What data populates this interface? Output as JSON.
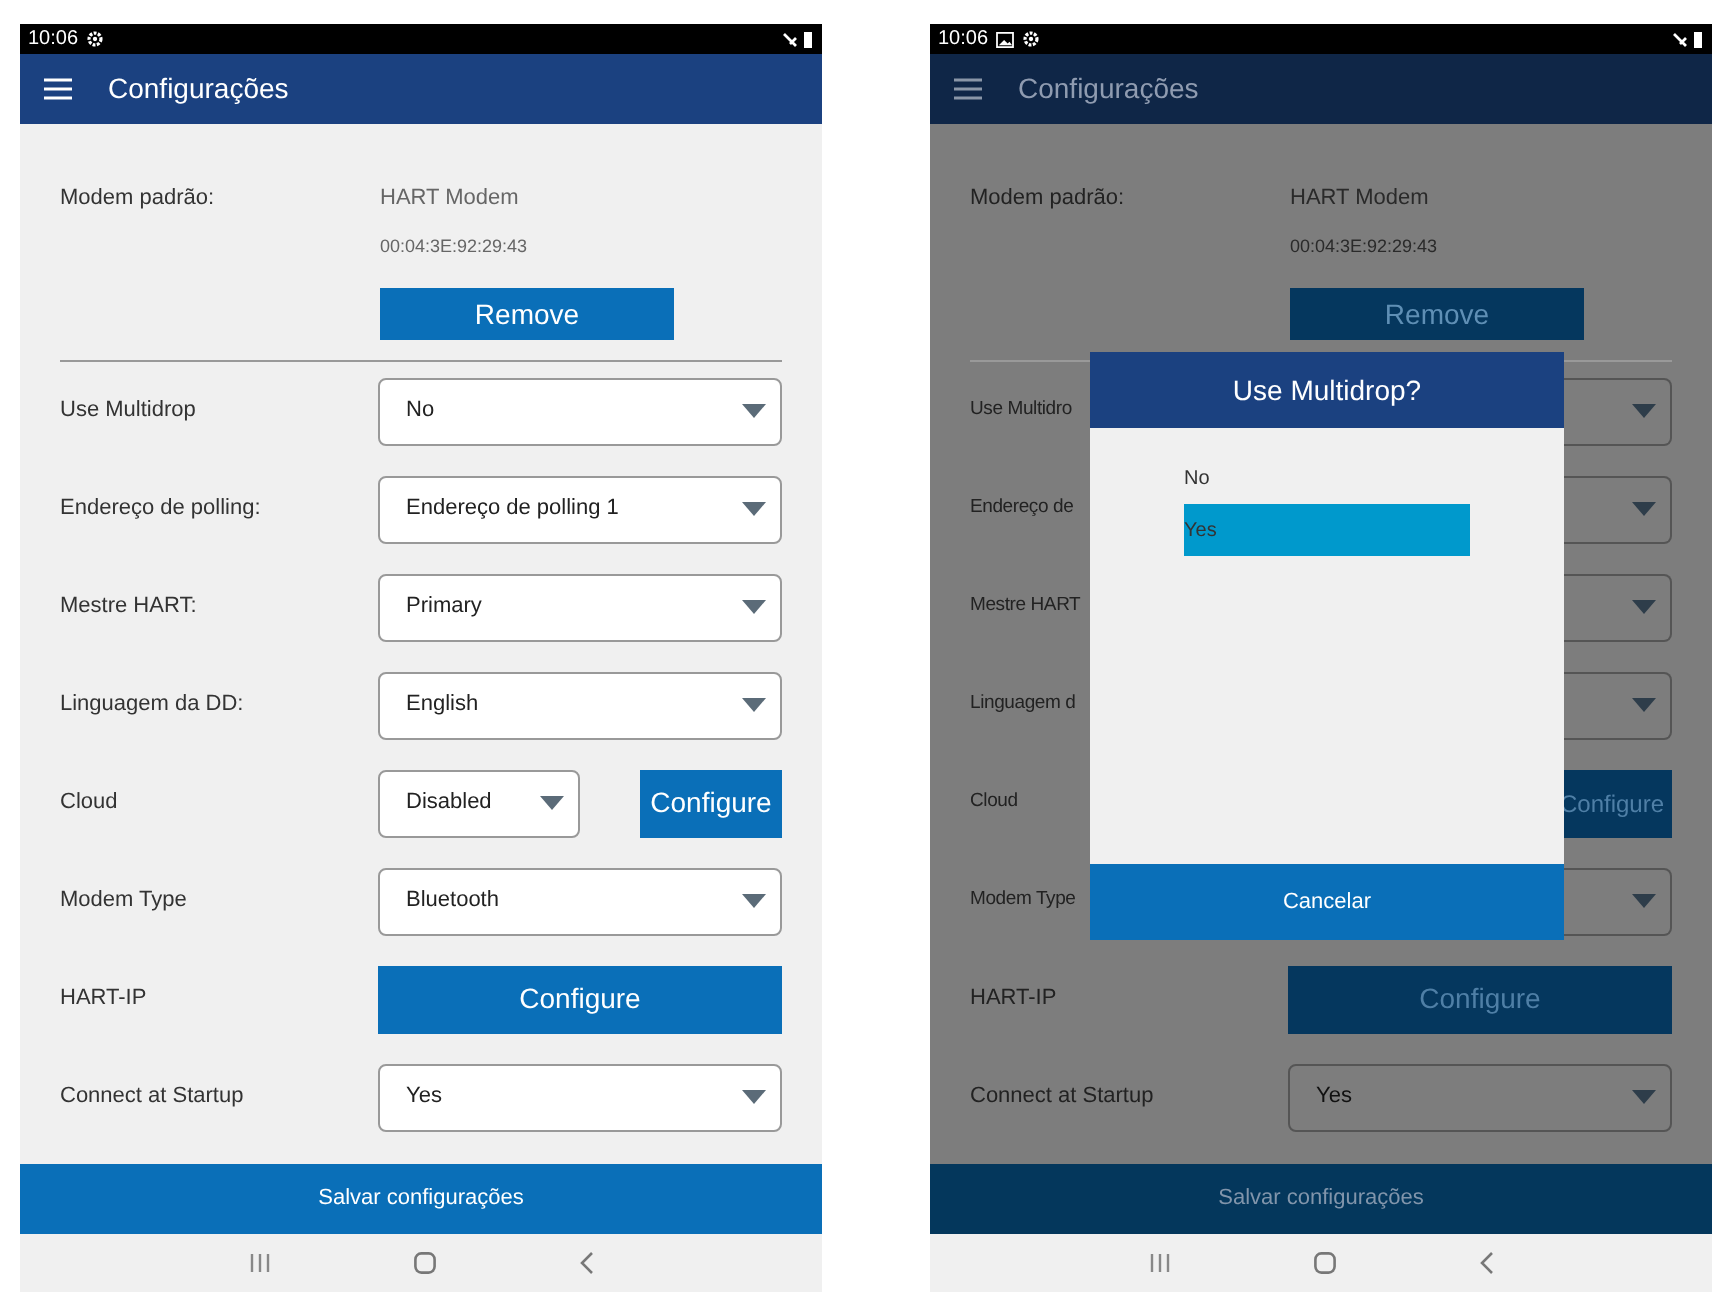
{
  "screens": [
    {
      "dimmed": false,
      "status_bar": {
        "time": "10:06",
        "picture_notification": false
      },
      "title": "Configurações",
      "modem": {
        "label": "Modem padrão:",
        "name": "HART Modem",
        "address": "00:04:3E:92:29:43",
        "button": "Remove"
      },
      "rows": [
        {
          "label": "Use Multidrop",
          "kind": "dropdown",
          "value": "No"
        },
        {
          "label": "Endereço de polling:",
          "kind": "dropdown",
          "value": "Endereço de polling 1"
        },
        {
          "label": "Mestre HART:",
          "kind": "dropdown",
          "value": "Primary"
        },
        {
          "label": "Linguagem da DD:",
          "kind": "dropdown",
          "value": "English"
        },
        {
          "label": "Cloud",
          "kind": "dropdown_button",
          "value": "Disabled",
          "button": "Configure"
        },
        {
          "label": "Modem Type",
          "kind": "dropdown",
          "value": "Bluetooth"
        },
        {
          "label": "HART-IP",
          "kind": "button",
          "button": "Configure"
        },
        {
          "label": "Connect at Startup",
          "kind": "dropdown",
          "value": "Yes"
        }
      ],
      "save_button": "Salvar configurações"
    },
    {
      "dimmed": true,
      "status_bar": {
        "time": "10:06",
        "picture_notification": true
      },
      "title": "Configurações",
      "modem": {
        "label": "Modem padrão:",
        "name": "HART Modem",
        "address": "00:04:3E:92:29:43",
        "button": "Remove"
      },
      "rows": [
        {
          "label": "Use Multidro",
          "kind": "dropdown_stub"
        },
        {
          "label": "Endereço de",
          "kind": "dropdown_stub"
        },
        {
          "label": "Mestre HART",
          "kind": "dropdown_stub"
        },
        {
          "label": "Linguagem d",
          "kind": "dropdown_stub"
        },
        {
          "label": "Cloud",
          "kind": "button_stub",
          "button": "Configure"
        },
        {
          "label": "Modem Type",
          "kind": "dropdown_stub"
        },
        {
          "label": "HART-IP",
          "kind": "button",
          "button": "Configure"
        },
        {
          "label": "Connect at Startup",
          "kind": "dropdown",
          "value": "Yes"
        }
      ],
      "save_button": "Salvar configurações",
      "dialog": {
        "title": "Use Multidrop?",
        "options": [
          {
            "label": "No",
            "selected": false
          },
          {
            "label": "Yes",
            "selected": true
          }
        ],
        "cancel": "Cancelar"
      }
    }
  ]
}
